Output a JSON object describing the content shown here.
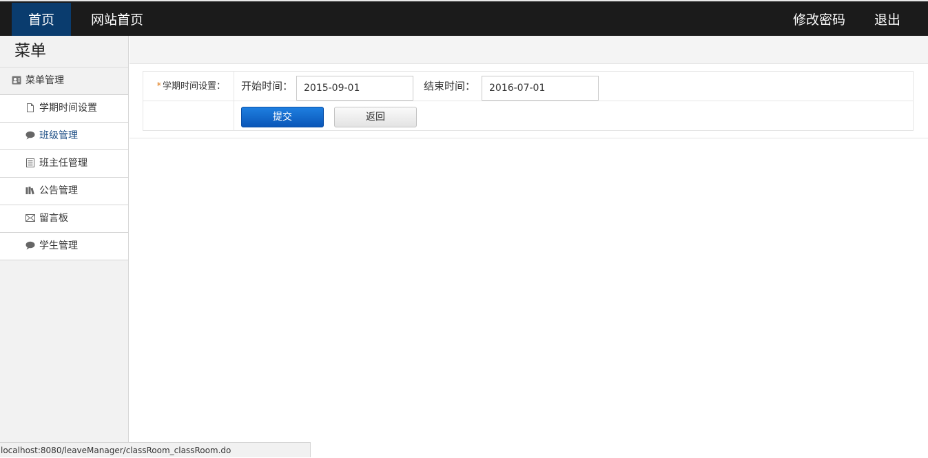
{
  "topnav": {
    "home": "首页",
    "site_home": "网站首页",
    "change_password": "修改密码",
    "logout": "退出"
  },
  "sidebar": {
    "title": "菜单",
    "group": "菜单管理",
    "items": [
      {
        "label": "学期时间设置",
        "icon": "document-icon"
      },
      {
        "label": "班级管理",
        "icon": "chat-bubble-icon",
        "active": true
      },
      {
        "label": "班主任管理",
        "icon": "list-icon"
      },
      {
        "label": "公告管理",
        "icon": "books-icon"
      },
      {
        "label": "留言板",
        "icon": "envelope-icon"
      },
      {
        "label": "学生管理",
        "icon": "chat-bubble-icon"
      }
    ]
  },
  "form": {
    "field_label": "学期时间设置：",
    "required_mark": "*",
    "start_label": "开始时间：",
    "start_value": "2015-09-01",
    "end_label": "结束时间：",
    "end_value": "2016-07-01",
    "submit": "提交",
    "back": "返回"
  },
  "statusbar": {
    "url": "localhost:8080/leaveManager/classRoom_classRoom.do"
  },
  "colors": {
    "topbar": "#1b1b1b",
    "nav_active": "#0a3c6e",
    "submit_button": "#0a56b8",
    "required": "#e07a18"
  }
}
